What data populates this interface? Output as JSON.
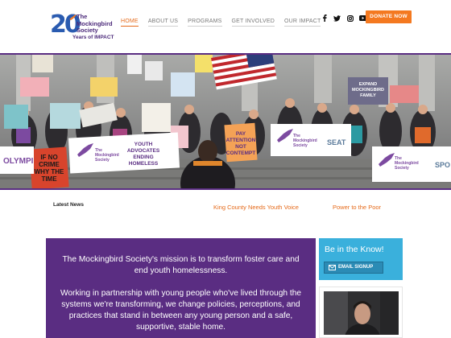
{
  "header": {
    "logo": {
      "number": "20",
      "name_line1": "The",
      "name_line2": "Mockingbird",
      "name_line3": "Society",
      "tagline": "Years of IMPACT"
    },
    "nav": [
      {
        "label": "HOME",
        "active": true
      },
      {
        "label": "ABOUT US",
        "active": false
      },
      {
        "label": "PROGRAMS",
        "active": false
      },
      {
        "label": "GET INVOLVED",
        "active": false
      },
      {
        "label": "OUR IMPACT",
        "active": false
      }
    ],
    "social_icons": [
      "facebook-icon",
      "twitter-icon",
      "instagram-icon",
      "youtube-icon"
    ],
    "donate_label": "DONATE NOW"
  },
  "hero": {
    "signs": {
      "sign1": "IF NO CRIME WHY THE TIME",
      "sign2": "YOUTH ADVOCATES ENDING HOMELESS",
      "sign3": "PAY ATTENTION NOT CONTEMPT",
      "sign4": "EXPAND MOCKINGBIRD FAMILY",
      "banner_left": "The Mockingbird Society",
      "banner_mid": "The Mockingbird Society",
      "banner_right": "The Mockingbird Society",
      "banner_left_edge": "OLYMPI",
      "banner_mid_edge": "SEAT",
      "banner_right_edge": "SPO"
    }
  },
  "news": {
    "label": "Latest News",
    "items": [
      "King County Needs Youth Voice",
      "Power to the Poor"
    ]
  },
  "mission": {
    "p1": "The Mockingbird Society's mission is to transform foster care and end youth homelessness.",
    "p2": "Working in partnership with young people who've lived through the systems we're transforming, we change policies, perceptions, and practices that stand in between any young person and a safe, supportive, stable home."
  },
  "sidebar": {
    "know_title": "Be in the Know!",
    "signup_label": "EMAIL SIGNUP"
  },
  "colors": {
    "purple": "#5a2d82",
    "orange": "#f47920",
    "blue": "#3ab0dc"
  }
}
